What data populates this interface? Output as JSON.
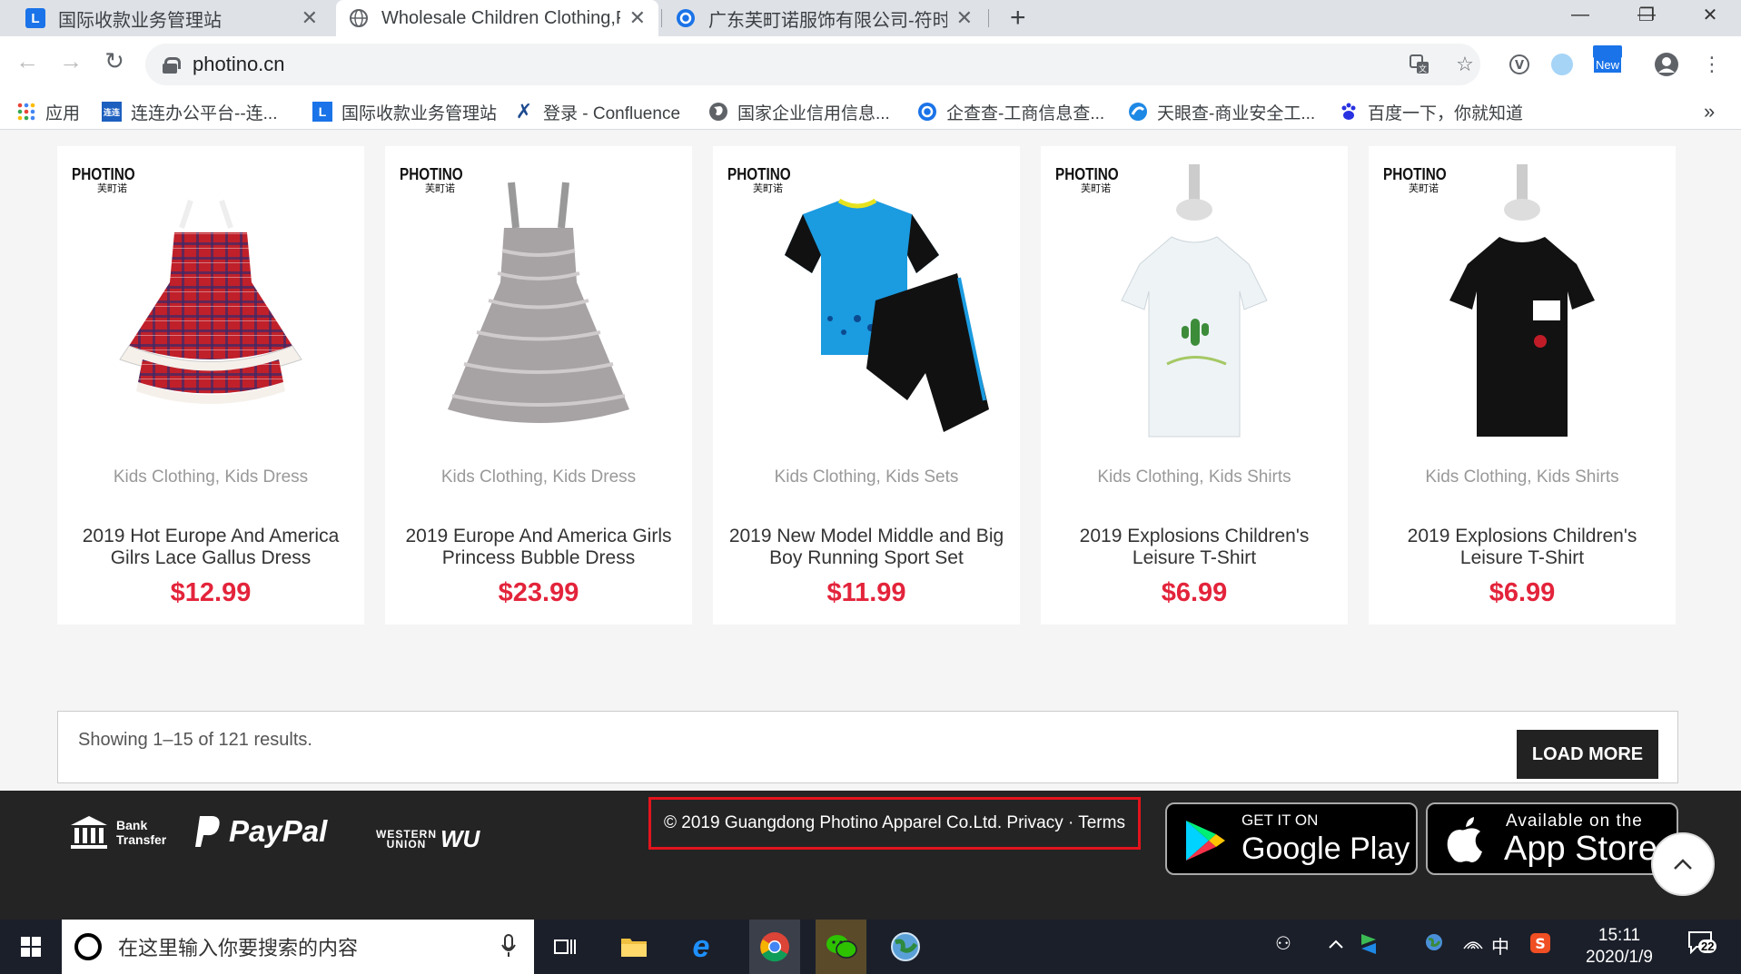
{
  "browser": {
    "tabs": [
      {
        "title": "国际收款业务管理站",
        "favicon": "L",
        "favicon_color": "#1a73e8"
      },
      {
        "title": "Wholesale Children Clothing,P",
        "favicon": "globe-icon",
        "active": true
      },
      {
        "title": "广东芙町诺服饰有限公司-符时钊",
        "favicon": "qichacha-icon",
        "favicon_color": "#1a73e8"
      }
    ],
    "new_tab_symbol": "+",
    "url": "photino.cn",
    "new_badge": "New",
    "bookmarks": [
      {
        "label": "应用",
        "icon": "apps-grid-icon"
      },
      {
        "label": "连连办公平台--连...",
        "icon": "lianlian-icon"
      },
      {
        "label": "国际收款业务管理站",
        "icon": "L"
      },
      {
        "label": "登录 - Confluence",
        "icon": "confluence-icon"
      },
      {
        "label": "国家企业信用信息...",
        "icon": "globe-icon"
      },
      {
        "label": "企查查-工商信息查...",
        "icon": "qichacha-icon"
      },
      {
        "label": "天眼查-商业安全工...",
        "icon": "tianyancha-icon"
      },
      {
        "label": "百度一下，你就知道",
        "icon": "baidu-paw-icon"
      }
    ],
    "bookmarks_overflow": "»"
  },
  "products": [
    {
      "brand": "PHOTINO",
      "brand_cn": "芙町诺",
      "category": "Kids Clothing, Kids Dress",
      "name": "2019 Hot Europe And America Gilrs Lace Gallus Dress",
      "price": "$12.99"
    },
    {
      "brand": "PHOTINO",
      "brand_cn": "芙町诺",
      "category": "Kids Clothing, Kids Dress",
      "name": "2019 Europe And America Girls Princess Bubble Dress",
      "price": "$23.99"
    },
    {
      "brand": "PHOTINO",
      "brand_cn": "芙町诺",
      "category": "Kids Clothing, Kids Sets",
      "name": "2019 New Model Middle and Big Boy Running Sport Set",
      "price": "$11.99"
    },
    {
      "brand": "PHOTINO",
      "brand_cn": "芙町诺",
      "category": "Kids Clothing, Kids Shirts",
      "name": "2019 Explosions Children's Leisure T-Shirt",
      "price": "$6.99"
    },
    {
      "brand": "PHOTINO",
      "brand_cn": "芙町诺",
      "category": "Kids Clothing, Kids Shirts",
      "name": "2019 Explosions Children's Leisure T-Shirt",
      "price": "$6.99"
    }
  ],
  "results": {
    "text": "Showing 1–15   of  121  results.",
    "load_more": "LOAD MORE"
  },
  "footer": {
    "bank_line1": "Bank",
    "bank_line2": "Transfer",
    "paypal": "PayPal",
    "wu_line1": "WESTERN",
    "wu_line2": "UNION",
    "wu_mark": "WU",
    "copyright": "© 2019 Guangdong Photino Apparel Co.Ltd. Privacy · Terms",
    "google_small": "GET IT ON",
    "google_big": "Google Play",
    "apple_small": "Available on the",
    "apple_big": "App Store",
    "scroll_top": "^"
  },
  "taskbar": {
    "search_placeholder": "在这里输入你要搜索的内容",
    "ime": "中",
    "time": "15:11",
    "date": "2020/1/9",
    "notifications": "22"
  }
}
